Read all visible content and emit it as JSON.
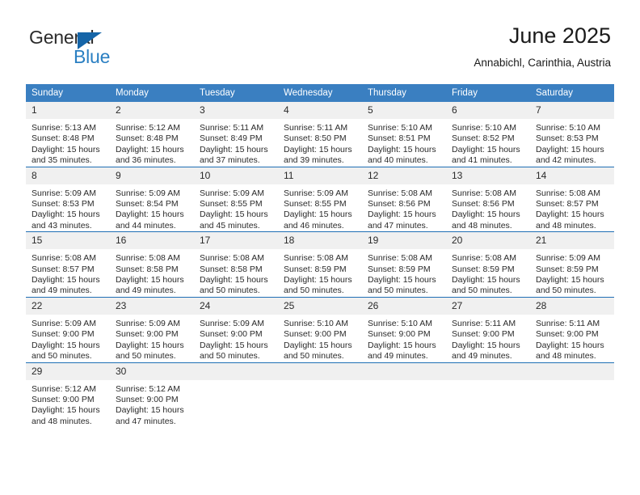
{
  "brand": {
    "name_part1": "General",
    "name_part2": "Blue",
    "accent_color": "#2a7fc2",
    "triangle_color": "#1565a8"
  },
  "header": {
    "title": "June 2025",
    "subtitle": "Annabichl, Carinthia, Austria"
  },
  "calendar": {
    "header_bg": "#3a7fc1",
    "daynum_bg": "#f0f0f0",
    "row_divider_color": "#1f6fb5",
    "weekday_headers": [
      "Sunday",
      "Monday",
      "Tuesday",
      "Wednesday",
      "Thursday",
      "Friday",
      "Saturday"
    ],
    "weeks": [
      [
        {
          "day": "1",
          "sunrise": "Sunrise: 5:13 AM",
          "sunset": "Sunset: 8:48 PM",
          "daylight_line1": "Daylight: 15 hours",
          "daylight_line2": "and 35 minutes."
        },
        {
          "day": "2",
          "sunrise": "Sunrise: 5:12 AM",
          "sunset": "Sunset: 8:48 PM",
          "daylight_line1": "Daylight: 15 hours",
          "daylight_line2": "and 36 minutes."
        },
        {
          "day": "3",
          "sunrise": "Sunrise: 5:11 AM",
          "sunset": "Sunset: 8:49 PM",
          "daylight_line1": "Daylight: 15 hours",
          "daylight_line2": "and 37 minutes."
        },
        {
          "day": "4",
          "sunrise": "Sunrise: 5:11 AM",
          "sunset": "Sunset: 8:50 PM",
          "daylight_line1": "Daylight: 15 hours",
          "daylight_line2": "and 39 minutes."
        },
        {
          "day": "5",
          "sunrise": "Sunrise: 5:10 AM",
          "sunset": "Sunset: 8:51 PM",
          "daylight_line1": "Daylight: 15 hours",
          "daylight_line2": "and 40 minutes."
        },
        {
          "day": "6",
          "sunrise": "Sunrise: 5:10 AM",
          "sunset": "Sunset: 8:52 PM",
          "daylight_line1": "Daylight: 15 hours",
          "daylight_line2": "and 41 minutes."
        },
        {
          "day": "7",
          "sunrise": "Sunrise: 5:10 AM",
          "sunset": "Sunset: 8:53 PM",
          "daylight_line1": "Daylight: 15 hours",
          "daylight_line2": "and 42 minutes."
        }
      ],
      [
        {
          "day": "8",
          "sunrise": "Sunrise: 5:09 AM",
          "sunset": "Sunset: 8:53 PM",
          "daylight_line1": "Daylight: 15 hours",
          "daylight_line2": "and 43 minutes."
        },
        {
          "day": "9",
          "sunrise": "Sunrise: 5:09 AM",
          "sunset": "Sunset: 8:54 PM",
          "daylight_line1": "Daylight: 15 hours",
          "daylight_line2": "and 44 minutes."
        },
        {
          "day": "10",
          "sunrise": "Sunrise: 5:09 AM",
          "sunset": "Sunset: 8:55 PM",
          "daylight_line1": "Daylight: 15 hours",
          "daylight_line2": "and 45 minutes."
        },
        {
          "day": "11",
          "sunrise": "Sunrise: 5:09 AM",
          "sunset": "Sunset: 8:55 PM",
          "daylight_line1": "Daylight: 15 hours",
          "daylight_line2": "and 46 minutes."
        },
        {
          "day": "12",
          "sunrise": "Sunrise: 5:08 AM",
          "sunset": "Sunset: 8:56 PM",
          "daylight_line1": "Daylight: 15 hours",
          "daylight_line2": "and 47 minutes."
        },
        {
          "day": "13",
          "sunrise": "Sunrise: 5:08 AM",
          "sunset": "Sunset: 8:56 PM",
          "daylight_line1": "Daylight: 15 hours",
          "daylight_line2": "and 48 minutes."
        },
        {
          "day": "14",
          "sunrise": "Sunrise: 5:08 AM",
          "sunset": "Sunset: 8:57 PM",
          "daylight_line1": "Daylight: 15 hours",
          "daylight_line2": "and 48 minutes."
        }
      ],
      [
        {
          "day": "15",
          "sunrise": "Sunrise: 5:08 AM",
          "sunset": "Sunset: 8:57 PM",
          "daylight_line1": "Daylight: 15 hours",
          "daylight_line2": "and 49 minutes."
        },
        {
          "day": "16",
          "sunrise": "Sunrise: 5:08 AM",
          "sunset": "Sunset: 8:58 PM",
          "daylight_line1": "Daylight: 15 hours",
          "daylight_line2": "and 49 minutes."
        },
        {
          "day": "17",
          "sunrise": "Sunrise: 5:08 AM",
          "sunset": "Sunset: 8:58 PM",
          "daylight_line1": "Daylight: 15 hours",
          "daylight_line2": "and 50 minutes."
        },
        {
          "day": "18",
          "sunrise": "Sunrise: 5:08 AM",
          "sunset": "Sunset: 8:59 PM",
          "daylight_line1": "Daylight: 15 hours",
          "daylight_line2": "and 50 minutes."
        },
        {
          "day": "19",
          "sunrise": "Sunrise: 5:08 AM",
          "sunset": "Sunset: 8:59 PM",
          "daylight_line1": "Daylight: 15 hours",
          "daylight_line2": "and 50 minutes."
        },
        {
          "day": "20",
          "sunrise": "Sunrise: 5:08 AM",
          "sunset": "Sunset: 8:59 PM",
          "daylight_line1": "Daylight: 15 hours",
          "daylight_line2": "and 50 minutes."
        },
        {
          "day": "21",
          "sunrise": "Sunrise: 5:09 AM",
          "sunset": "Sunset: 8:59 PM",
          "daylight_line1": "Daylight: 15 hours",
          "daylight_line2": "and 50 minutes."
        }
      ],
      [
        {
          "day": "22",
          "sunrise": "Sunrise: 5:09 AM",
          "sunset": "Sunset: 9:00 PM",
          "daylight_line1": "Daylight: 15 hours",
          "daylight_line2": "and 50 minutes."
        },
        {
          "day": "23",
          "sunrise": "Sunrise: 5:09 AM",
          "sunset": "Sunset: 9:00 PM",
          "daylight_line1": "Daylight: 15 hours",
          "daylight_line2": "and 50 minutes."
        },
        {
          "day": "24",
          "sunrise": "Sunrise: 5:09 AM",
          "sunset": "Sunset: 9:00 PM",
          "daylight_line1": "Daylight: 15 hours",
          "daylight_line2": "and 50 minutes."
        },
        {
          "day": "25",
          "sunrise": "Sunrise: 5:10 AM",
          "sunset": "Sunset: 9:00 PM",
          "daylight_line1": "Daylight: 15 hours",
          "daylight_line2": "and 50 minutes."
        },
        {
          "day": "26",
          "sunrise": "Sunrise: 5:10 AM",
          "sunset": "Sunset: 9:00 PM",
          "daylight_line1": "Daylight: 15 hours",
          "daylight_line2": "and 49 minutes."
        },
        {
          "day": "27",
          "sunrise": "Sunrise: 5:11 AM",
          "sunset": "Sunset: 9:00 PM",
          "daylight_line1": "Daylight: 15 hours",
          "daylight_line2": "and 49 minutes."
        },
        {
          "day": "28",
          "sunrise": "Sunrise: 5:11 AM",
          "sunset": "Sunset: 9:00 PM",
          "daylight_line1": "Daylight: 15 hours",
          "daylight_line2": "and 48 minutes."
        }
      ],
      [
        {
          "day": "29",
          "sunrise": "Sunrise: 5:12 AM",
          "sunset": "Sunset: 9:00 PM",
          "daylight_line1": "Daylight: 15 hours",
          "daylight_line2": "and 48 minutes."
        },
        {
          "day": "30",
          "sunrise": "Sunrise: 5:12 AM",
          "sunset": "Sunset: 9:00 PM",
          "daylight_line1": "Daylight: 15 hours",
          "daylight_line2": "and 47 minutes."
        },
        {
          "day": "",
          "sunrise": "",
          "sunset": "",
          "daylight_line1": "",
          "daylight_line2": ""
        },
        {
          "day": "",
          "sunrise": "",
          "sunset": "",
          "daylight_line1": "",
          "daylight_line2": ""
        },
        {
          "day": "",
          "sunrise": "",
          "sunset": "",
          "daylight_line1": "",
          "daylight_line2": ""
        },
        {
          "day": "",
          "sunrise": "",
          "sunset": "",
          "daylight_line1": "",
          "daylight_line2": ""
        },
        {
          "day": "",
          "sunrise": "",
          "sunset": "",
          "daylight_line1": "",
          "daylight_line2": ""
        }
      ]
    ]
  }
}
